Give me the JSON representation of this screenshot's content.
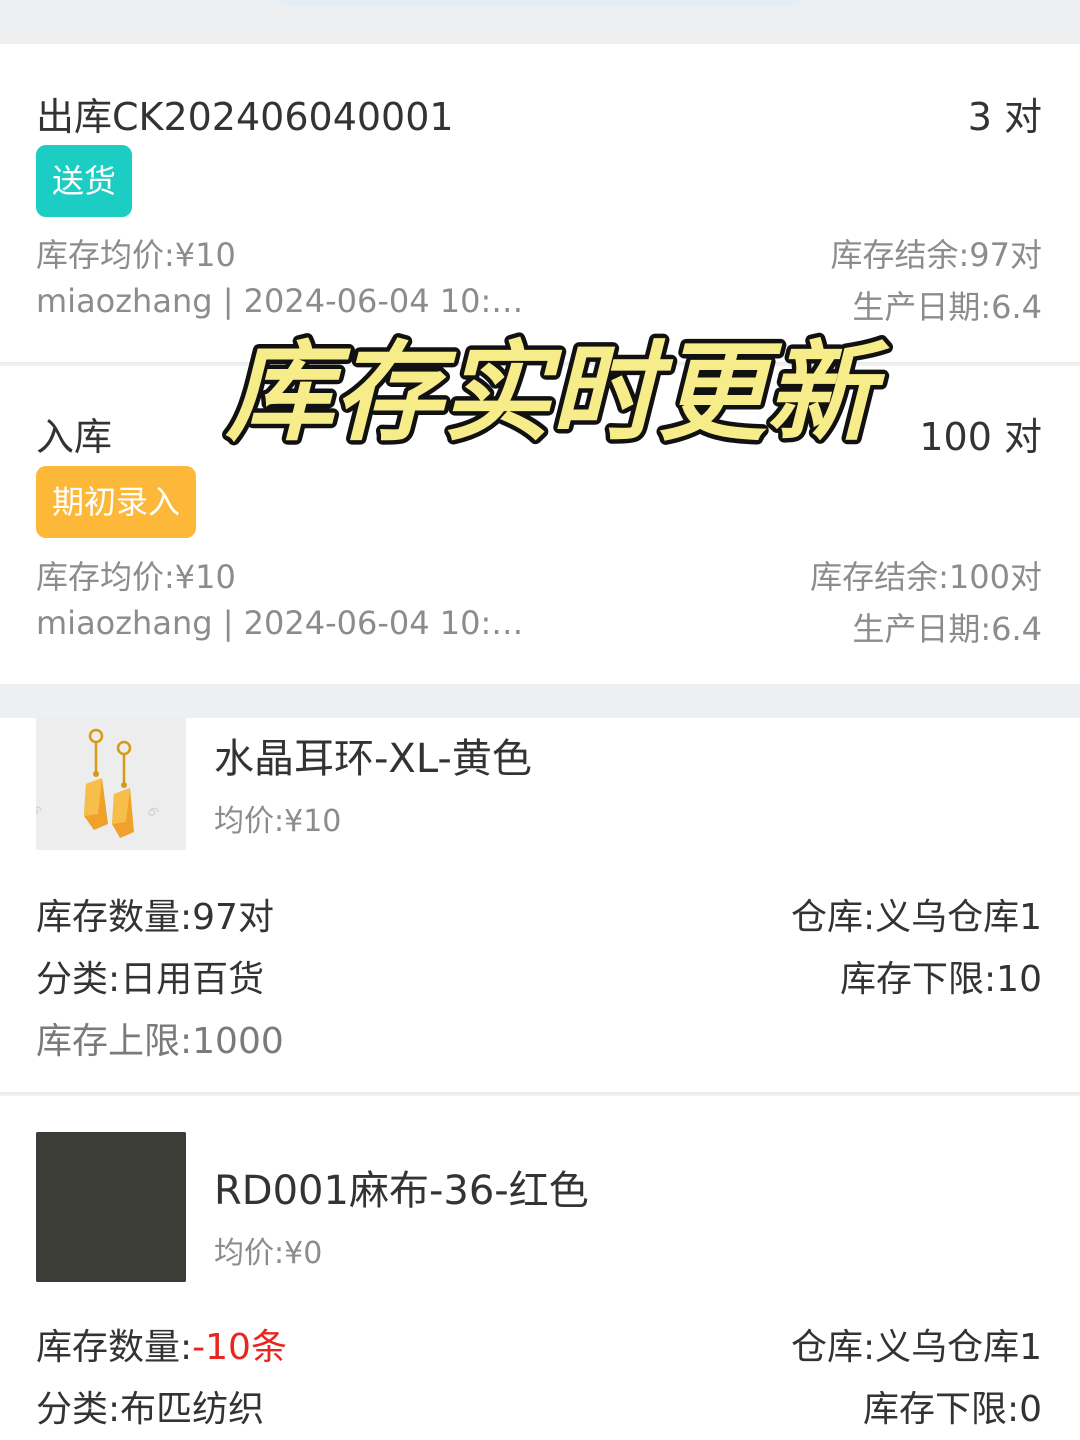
{
  "transactions": [
    {
      "title": "出库CK202406040001",
      "quantity": "3 对",
      "badge": "送货",
      "badge_color": "#1ccdc3",
      "avg_price": "库存均价:¥10",
      "balance": "库存结余:97对",
      "operator_time": "miaozhang | 2024-06-04 10:…",
      "production_date": "生产日期:6.4"
    },
    {
      "title": "入库",
      "quantity": "100 对",
      "badge": "期初录入",
      "badge_color": "#fdb83a",
      "avg_price": "库存均价:¥10",
      "balance": "库存结余:100对",
      "operator_time": "miaozhang | 2024-06-04 10:…",
      "production_date": "生产日期:6.4"
    }
  ],
  "overlay_caption": "库存实时更新",
  "products": [
    {
      "name": "水晶耳环-XL-黄色",
      "avg_price": "均价:¥10",
      "stock_label": "库存数量:",
      "stock_value": "97对",
      "warehouse": "仓库:义乌仓库1",
      "category": "分类:日用百货",
      "min_stock": "库存下限:10",
      "max_stock": "库存上限:1000",
      "thumbnail_icon": "earring-icon"
    },
    {
      "name": "RD001麻布-36-红色",
      "avg_price": "均价:¥0",
      "stock_label": "库存数量:",
      "stock_value": "-10条",
      "warehouse": "仓库:义乌仓库1",
      "category": "分类:布匹纺织",
      "min_stock": "库存下限:0",
      "thumbnail_icon": "fabric-swatch-icon"
    }
  ],
  "colors": {
    "negative_stock": "#e8261f",
    "caption_fill": "#f7ec8a",
    "caption_stroke": "#111111"
  }
}
